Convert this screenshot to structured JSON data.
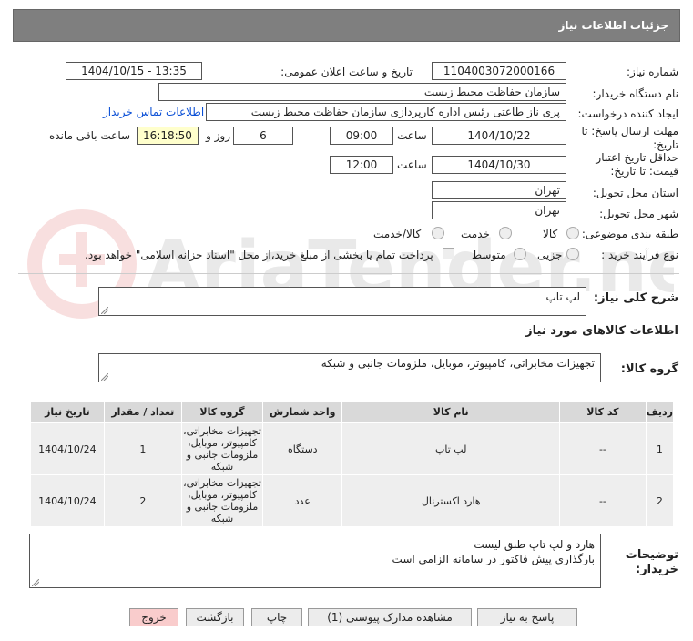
{
  "header": {
    "title": "جزئیات اطلاعات نیاز"
  },
  "fields": {
    "need_number_label": "شماره نیاز:",
    "need_number": "1104003072000166",
    "announce_label": "تاریخ و ساعت اعلان عمومی:",
    "announce_value": "1404/10/15 - 13:35",
    "buyer_label": "نام دستگاه خریدار:",
    "buyer_value": "سازمان حفاظت محیط زیست",
    "creator_label": "ایجاد کننده درخواست:",
    "creator_value": "پری ناز طاعتی رئیس اداره کارپردازی سازمان حفاظت محیط زیست",
    "contact_link": "اطلاعات تماس خریدار",
    "deadline_label": "مهلت ارسال پاسخ: تا تاریخ:",
    "deadline_date": "1404/10/22",
    "time_word": "ساعت",
    "deadline_time": "09:00",
    "days_value": "6",
    "days_word": "روز و",
    "remaining_time": "16:18:50",
    "remaining_word": "ساعت باقی مانده",
    "validity_label": "حداقل تاریخ اعتبار قیمت: تا تاریخ:",
    "validity_date": "1404/10/30",
    "validity_time": "12:00",
    "province_label": "استان محل تحویل:",
    "province_value": "تهران",
    "city_label": "شهر محل تحویل:",
    "city_value": "تهران",
    "category_label": "طبقه بندی موضوعی:",
    "category_options": [
      "کالا",
      "خدمت",
      "کالا/خدمت"
    ],
    "process_label": "نوع فرآیند خرید :",
    "process_options": [
      "جزیی",
      "متوسط"
    ],
    "payment_note": "پرداخت تمام یا بخشی از مبلغ خرید،از محل \"اسناد خزانه اسلامی\" خواهد بود."
  },
  "description": {
    "label": "شرح کلی نیاز:",
    "value": "لپ تاپ"
  },
  "goods_section": {
    "title": "اطلاعات کالاهای مورد نیاز"
  },
  "goods_group": {
    "label": "گروه کالا:",
    "value": "تجهیزات مخابراتی، کامپیوتر، موبایل، ملزومات جانبی و شبکه"
  },
  "table": {
    "headers": [
      "ردیف",
      "کد کالا",
      "نام کالا",
      "واحد شمارش",
      "گروه کالا",
      "تعداد / مقدار",
      "تاریخ نیاز"
    ],
    "rows": [
      [
        "1",
        "--",
        "لپ تاپ",
        "دستگاه",
        "تجهیزات مخابراتی، کامپیوتر، موبایل، ملزومات جانبی و شبکه",
        "1",
        "1404/10/24"
      ],
      [
        "2",
        "--",
        "هارد اکسترنال",
        "عدد",
        "تجهیزات مخابراتی، کامپیوتر، موبایل، ملزومات جانبی و شبکه",
        "2",
        "1404/10/24"
      ]
    ]
  },
  "buyer_notes": {
    "label": "توضیحات خریدار:",
    "line1": "هارد و لپ تاپ طبق لیست",
    "line2": "بارگذاری پیش فاکتور در سامانه الزامی است"
  },
  "buttons": {
    "reply": "پاسخ به نیاز",
    "view_docs": "مشاهده مدارک پیوستی (1)",
    "print": "چاپ",
    "back": "بازگشت",
    "exit": "خروج"
  },
  "watermark": {
    "text": "AriaTender.net"
  },
  "colors": {
    "header_bg": "#7f7f7f",
    "link": "#0a4fd6",
    "exit_button": "#f9cccc",
    "highlight_box": "#ffffcc"
  }
}
